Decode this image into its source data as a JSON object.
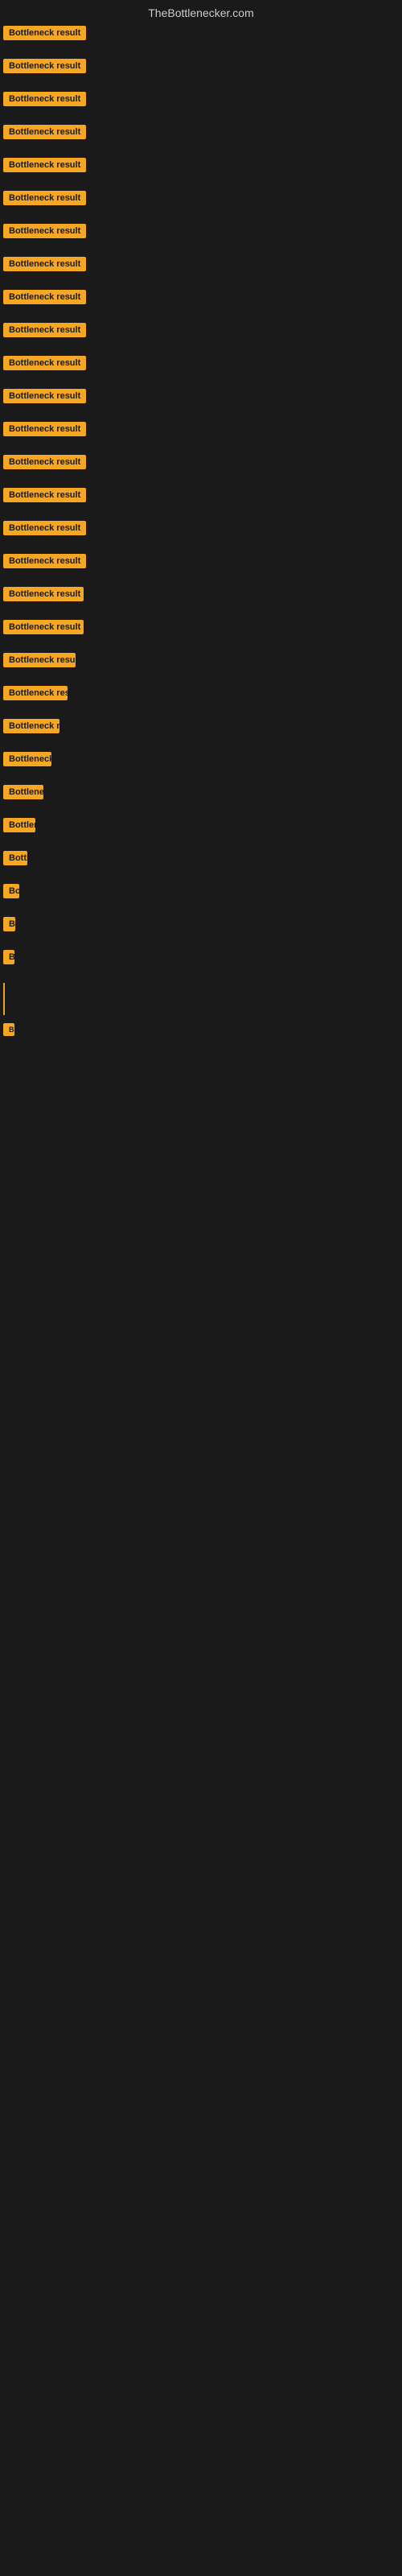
{
  "site": {
    "title": "TheBottlenecker.com"
  },
  "items": [
    {
      "id": 1,
      "label": "Bottleneck result",
      "size_class": "item-full"
    },
    {
      "id": 2,
      "label": "Bottleneck result",
      "size_class": "item-full"
    },
    {
      "id": 3,
      "label": "Bottleneck result",
      "size_class": "item-full"
    },
    {
      "id": 4,
      "label": "Bottleneck result",
      "size_class": "item-full"
    },
    {
      "id": 5,
      "label": "Bottleneck result",
      "size_class": "item-full"
    },
    {
      "id": 6,
      "label": "Bottleneck result",
      "size_class": "item-full"
    },
    {
      "id": 7,
      "label": "Bottleneck result",
      "size_class": "item-full"
    },
    {
      "id": 8,
      "label": "Bottleneck result",
      "size_class": "item-full"
    },
    {
      "id": 9,
      "label": "Bottleneck result",
      "size_class": "item-full"
    },
    {
      "id": 10,
      "label": "Bottleneck result",
      "size_class": "item-full"
    },
    {
      "id": 11,
      "label": "Bottleneck result",
      "size_class": "item-full"
    },
    {
      "id": 12,
      "label": "Bottleneck result",
      "size_class": "item-full"
    },
    {
      "id": 13,
      "label": "Bottleneck result",
      "size_class": "item-full"
    },
    {
      "id": 14,
      "label": "Bottleneck result",
      "size_class": "item-full"
    },
    {
      "id": 15,
      "label": "Bottleneck result",
      "size_class": "item-clip1"
    },
    {
      "id": 16,
      "label": "Bottleneck result",
      "size_class": "item-clip2"
    },
    {
      "id": 17,
      "label": "Bottleneck result",
      "size_class": "item-clip3"
    },
    {
      "id": 18,
      "label": "Bottleneck result",
      "size_class": "item-clip4"
    },
    {
      "id": 19,
      "label": "Bottleneck result",
      "size_class": "item-clip4"
    },
    {
      "id": 20,
      "label": "Bottleneck result",
      "size_class": "item-clip5"
    },
    {
      "id": 21,
      "label": "Bottleneck result",
      "size_class": "item-clip6"
    },
    {
      "id": 22,
      "label": "Bottleneck result",
      "size_class": "item-clip7"
    },
    {
      "id": 23,
      "label": "Bottleneck result",
      "size_class": "item-clip8"
    },
    {
      "id": 24,
      "label": "Bottleneck result",
      "size_class": "item-clip9"
    },
    {
      "id": 25,
      "label": "Bottleneck result",
      "size_class": "item-clip10"
    },
    {
      "id": 26,
      "label": "Bottleneck result",
      "size_class": "item-clip11"
    },
    {
      "id": 27,
      "label": "Bottleneck result",
      "size_class": "item-clip12"
    },
    {
      "id": 28,
      "label": "Bottleneck result",
      "size_class": "item-clip13"
    },
    {
      "id": 29,
      "label": "Bottleneck result",
      "size_class": "item-clip14"
    },
    {
      "id": 30,
      "label": "Bottleneck result",
      "size_class": "item-invisible"
    }
  ]
}
